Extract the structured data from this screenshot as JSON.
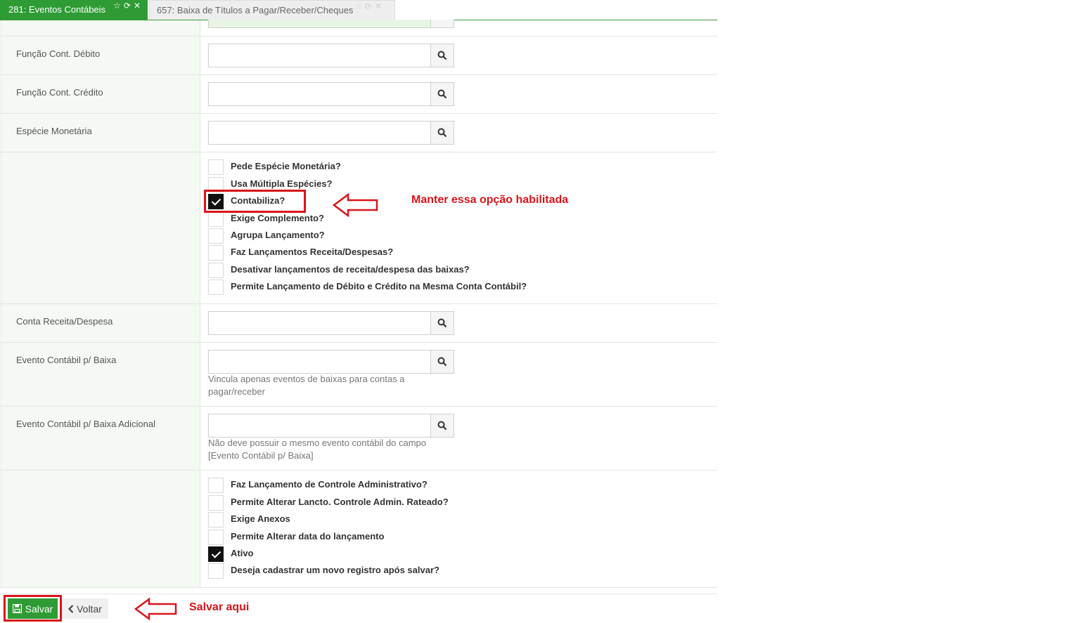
{
  "tabs": [
    {
      "label": "281: Eventos Contábeis",
      "active": true
    },
    {
      "label": "657: Baixa de Títulos a Pagar/Receber/Cheques",
      "active": false
    }
  ],
  "fields": {
    "funcao_debito": {
      "label": "Função Cont. Débito",
      "value": ""
    },
    "funcao_credito": {
      "label": "Função Cont. Crédito",
      "value": ""
    },
    "especie": {
      "label": "Espécie Monetária",
      "value": ""
    },
    "conta_receita": {
      "label": "Conta Receita/Despesa",
      "value": ""
    },
    "evento_baixa": {
      "label": "Evento Contábil p/ Baixa",
      "value": "",
      "help": "Vincula apenas eventos de baixas para contas a pagar/receber"
    },
    "evento_baixa_adicional": {
      "label": "Evento Contábil p/ Baixa Adicional",
      "value": "",
      "help": "Não deve possuir o mesmo evento contábil do campo [Evento Contábil p/ Baixa]"
    }
  },
  "checkbox_group_1": [
    {
      "label": "Pede Espécie Monetária?",
      "checked": false
    },
    {
      "label": "Usa Múltipla Espécies?",
      "checked": false
    },
    {
      "label": "Contabiliza?",
      "checked": true
    },
    {
      "label": "Exige Complemento?",
      "checked": false
    },
    {
      "label": "Agrupa Lançamento?",
      "checked": false
    },
    {
      "label": "Faz Lançamentos Receita/Despesas?",
      "checked": false
    },
    {
      "label": "Desativar lançamentos de receita/despesa das baixas?",
      "checked": false
    },
    {
      "label": "Permite Lançamento de Débito e Crédito na Mesma Conta Contábil?",
      "checked": false
    }
  ],
  "checkbox_group_2": [
    {
      "label": "Faz Lançamento de Controle Administrativo?",
      "checked": false
    },
    {
      "label": "Permite Alterar Lancto. Controle Admin. Rateado?",
      "checked": false
    },
    {
      "label": "Exige Anexos",
      "checked": false
    },
    {
      "label": "Permite Alterar data do lançamento",
      "checked": false
    },
    {
      "label": "Ativo",
      "checked": true
    },
    {
      "label": "Deseja cadastrar um novo registro após salvar?",
      "checked": false
    }
  ],
  "footer": {
    "save_label": "Salvar",
    "back_label": "Voltar"
  },
  "annotations": {
    "contabiliza_note": "Manter essa opção habilitada",
    "save_note": "Salvar aqui",
    "color": "#d9141b"
  },
  "colors": {
    "brand_green": "#2e9b34",
    "label_bg": "#f4f9f3"
  }
}
